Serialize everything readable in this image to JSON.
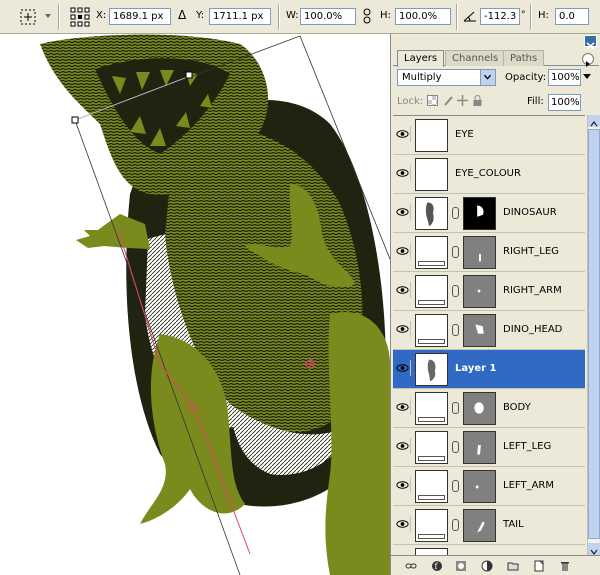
{
  "options_bar": {
    "x_label": "X:",
    "x_value": "1689.1 px",
    "delta_label": "Δ",
    "y_label": "Y:",
    "y_value": "1711.1 px",
    "w_label": "W:",
    "w_value": "100.0%",
    "h_label": "H:",
    "h_value": "100.0%",
    "angle_value": "-112.3",
    "skew_h_label": "H:",
    "skew_h_value": "0.0"
  },
  "layers_panel": {
    "tabs": [
      {
        "label": "Layers",
        "active": true
      },
      {
        "label": "Channels",
        "active": false
      },
      {
        "label": "Paths",
        "active": false
      }
    ],
    "blend_mode": "Multiply",
    "opacity_label": "Opacity:",
    "opacity_value": "100%",
    "lock_label": "Lock:",
    "fill_label": "Fill:",
    "fill_value": "100%",
    "layers": [
      {
        "name": "EYE",
        "thumb": "checker",
        "mask": null,
        "selected": false
      },
      {
        "name": "EYE_COLOUR",
        "thumb": "checker",
        "mask": null,
        "selected": false
      },
      {
        "name": "DINOSAUR",
        "thumb": "dino-sketch",
        "mask": "black",
        "selected": false
      },
      {
        "name": "RIGHT_LEG",
        "thumb": "olive",
        "mask": "gray",
        "selected": false
      },
      {
        "name": "RIGHT_ARM",
        "thumb": "olive",
        "mask": "gray",
        "selected": false
      },
      {
        "name": "DINO_HEAD",
        "thumb": "olive",
        "mask": "gray",
        "selected": false
      },
      {
        "name": "Layer 1",
        "thumb": "dino-sketch",
        "mask": null,
        "selected": true
      },
      {
        "name": "BODY",
        "thumb": "olive",
        "mask": "gray",
        "selected": false
      },
      {
        "name": "LEFT_LEG",
        "thumb": "olive",
        "mask": "gray",
        "selected": false
      },
      {
        "name": "LEFT_ARM",
        "thumb": "olive",
        "mask": "gray",
        "selected": false
      },
      {
        "name": "TAIL",
        "thumb": "olive",
        "mask": "gray",
        "selected": false
      }
    ]
  },
  "colors": {
    "olive": "#7a8a1c",
    "dark_olive": "#1e2410",
    "selection_blue": "#316ac5",
    "panel_bg": "#ece9d8"
  }
}
